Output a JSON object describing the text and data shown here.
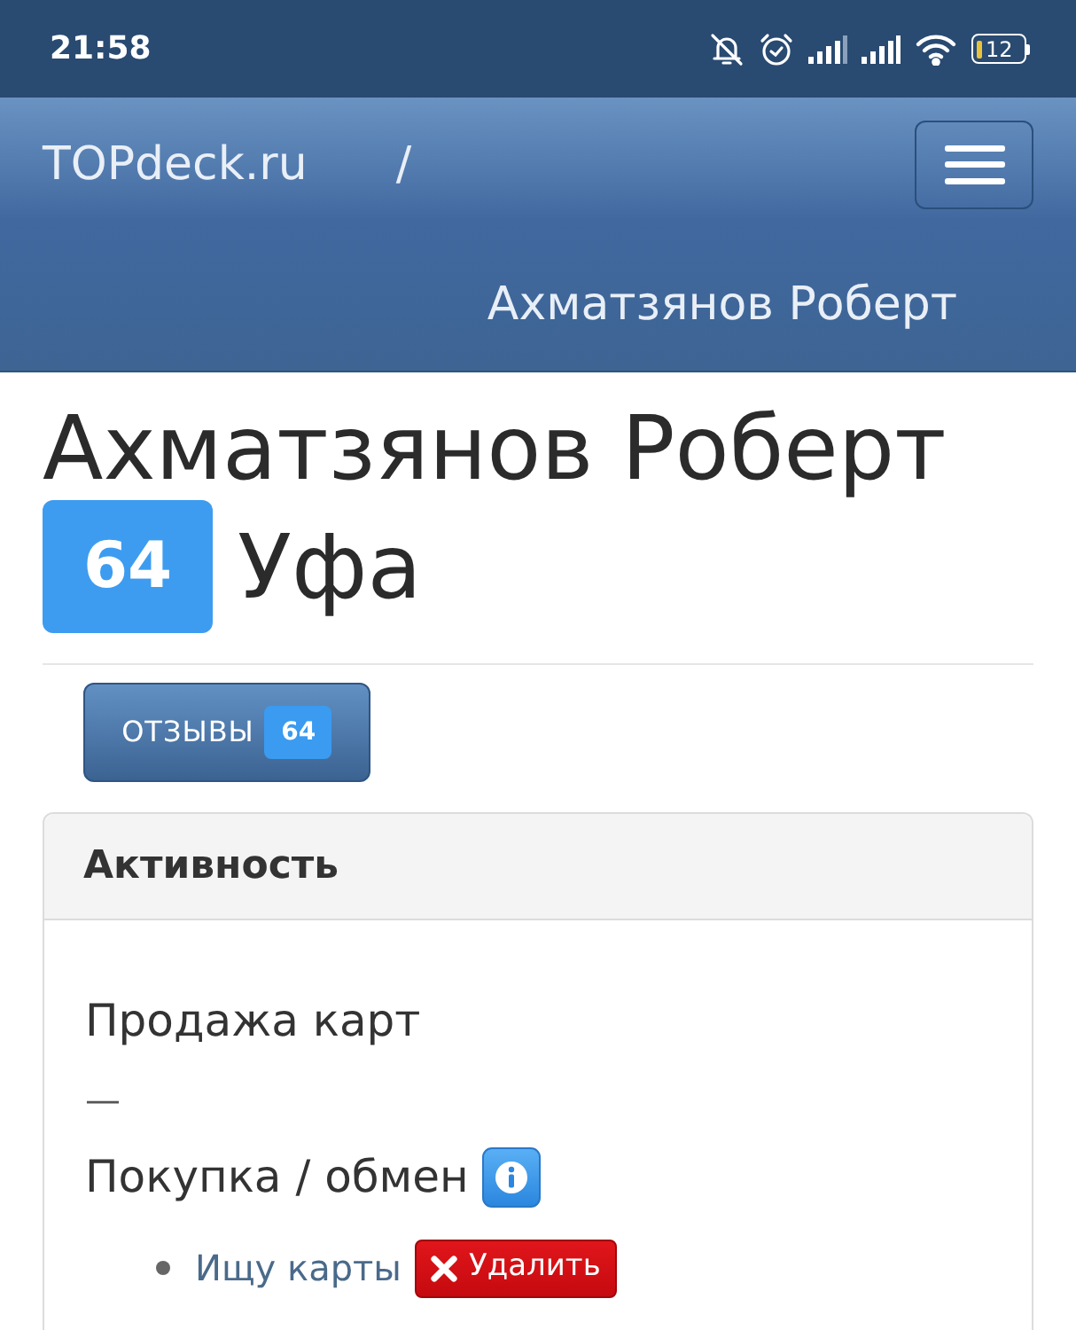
{
  "status_bar": {
    "time": "21:58",
    "battery": "12"
  },
  "navbar": {
    "brand": "TOPdeck.ru",
    "separator": "/",
    "page_title": "Ахматзянов Роберт"
  },
  "profile": {
    "name": "Ахматзянов Роберт",
    "rating": "64",
    "city": "Уфа"
  },
  "reviews_button": {
    "label": "ОТЗЫВЫ",
    "count": "64"
  },
  "activity_panel": {
    "title": "Активность",
    "sale_heading": "Продажа карт",
    "sale_empty": "—",
    "purchase_heading": "Покупка / обмен",
    "purchase_items": [
      {
        "label": "Ищу карты",
        "delete_label": "Удалить"
      }
    ]
  }
}
